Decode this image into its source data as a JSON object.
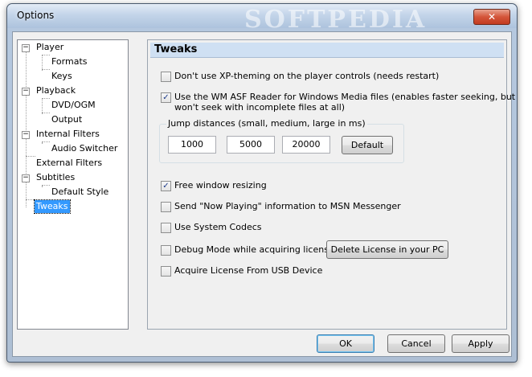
{
  "window": {
    "title": "Options",
    "watermark": "SOFTPEDIA",
    "close_glyph": "✕"
  },
  "tree": {
    "items": [
      {
        "label": "Player",
        "expander": "−"
      },
      {
        "label": "Formats"
      },
      {
        "label": "Keys"
      },
      {
        "label": "Playback",
        "expander": "−"
      },
      {
        "label": "DVD/OGM"
      },
      {
        "label": "Output"
      },
      {
        "label": "Internal Filters",
        "expander": "−"
      },
      {
        "label": "Audio Switcher"
      },
      {
        "label": "External Filters"
      },
      {
        "label": "Subtitles",
        "expander": "−"
      },
      {
        "label": "Default Style"
      },
      {
        "label": "Tweaks",
        "selected": true
      }
    ]
  },
  "panel": {
    "title": "Tweaks",
    "options": {
      "xp_theming": {
        "label": "Don't use XP-theming on the player controls (needs restart)",
        "checked": false
      },
      "wm_asf": {
        "label_line1": "Use the WM ASF Reader for Windows Media files (enables faster seeking, but",
        "label_line2": "won't seek with incomplete files at all)",
        "checked": true
      },
      "free_resize": {
        "label": "Free window resizing",
        "checked": true
      },
      "now_playing": {
        "label": "Send \"Now Playing\" information to MSN Messenger",
        "checked": false
      },
      "system_codecs": {
        "label": "Use System Codecs",
        "checked": false
      },
      "debug_mode": {
        "label": "Debug Mode while acquiring license.",
        "checked": false
      },
      "usb_license": {
        "label": "Acquire License From USB Device",
        "checked": false
      }
    },
    "jump": {
      "label": "Jump distances (small, medium, large in ms)",
      "small": "1000",
      "medium": "5000",
      "large": "20000",
      "default_button": "Default"
    },
    "delete_license_button": "Delete License in your PC",
    "check_glyph": "✓"
  },
  "buttons": {
    "ok": "OK",
    "cancel": "Cancel",
    "apply": "Apply"
  }
}
